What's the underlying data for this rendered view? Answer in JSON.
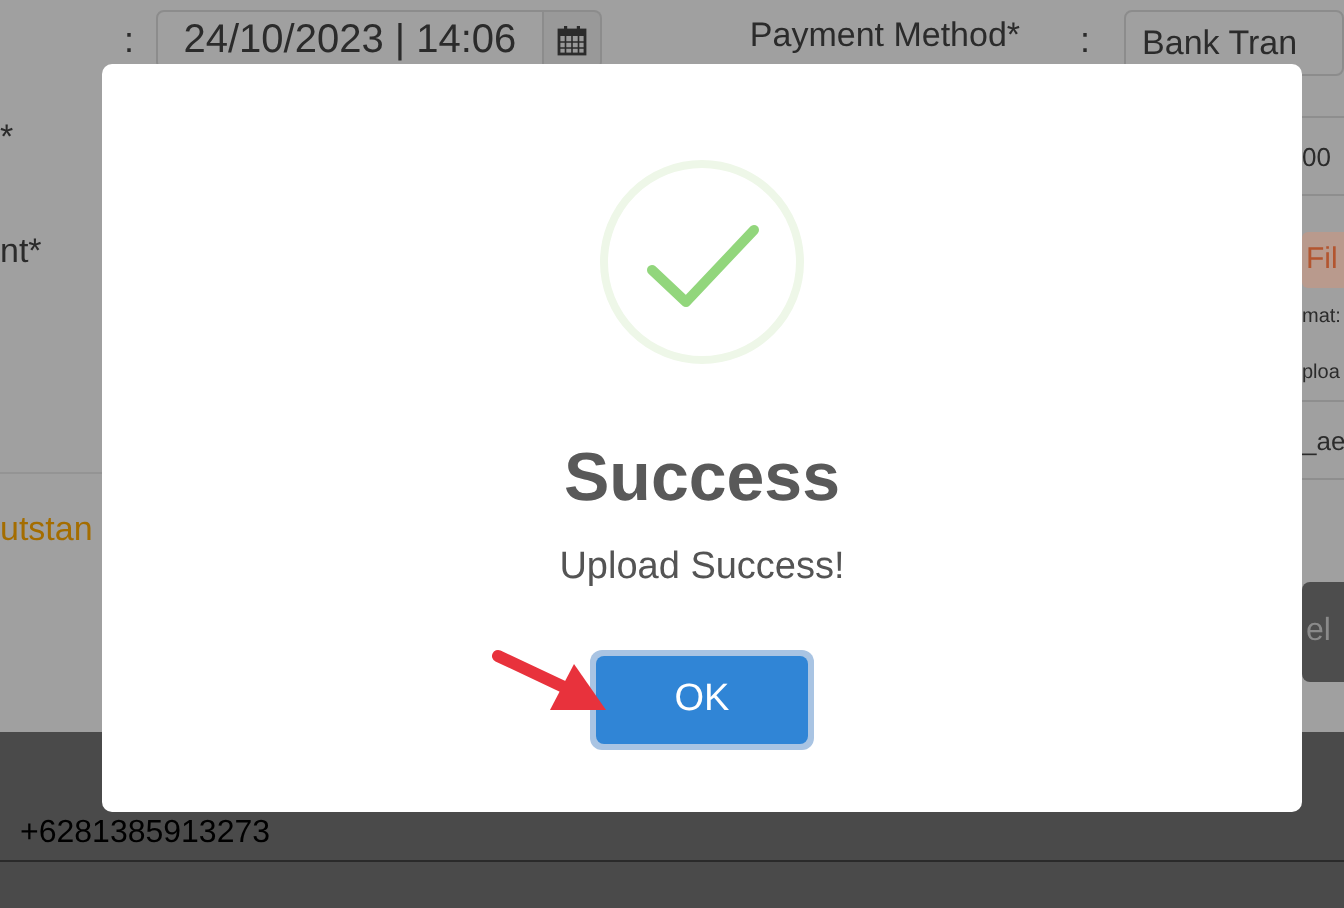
{
  "form": {
    "date_separator": ":",
    "date_field": {
      "value": "24/10/2023 | 14:06"
    },
    "payment_label": "Payment Method*",
    "payment_separator": ":",
    "payment_field": {
      "value": "Bank Tran"
    },
    "labels": [
      "*",
      "nt*"
    ],
    "right_column": [
      {
        "kind": "value",
        "text": "00"
      },
      {
        "kind": "button",
        "text": "Fil"
      },
      {
        "kind": "note",
        "text": "mat:"
      },
      {
        "kind": "note",
        "text": "ploa"
      },
      {
        "kind": "value",
        "text": "_ae"
      }
    ],
    "outstanding_text": "utstan",
    "action_button": "el"
  },
  "table_row": {
    "phone": "+6281385913273"
  },
  "dialog": {
    "title": "Success",
    "message": "Upload Success!",
    "confirm_button": "OK"
  }
}
